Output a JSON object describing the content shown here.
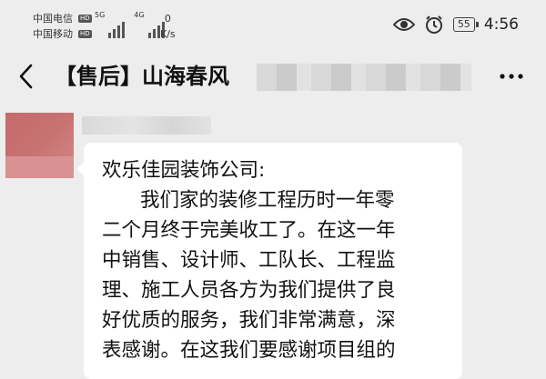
{
  "status_bar": {
    "carrier_1": "中国电信",
    "carrier_2": "中国移动",
    "hd_badge": "HD",
    "signal_1_label": "5G",
    "signal_2_label": "4G",
    "speed_value": "0",
    "speed_unit": "K/s",
    "battery": "55",
    "time": "4:56",
    "icons": [
      "eye-icon",
      "alarm-icon"
    ]
  },
  "header": {
    "title": "【售后】山海春风",
    "back_icon": "chevron-left-icon",
    "more_icon": "more-dots-icon"
  },
  "message": {
    "lines": [
      "欢乐佳园装饰公司:",
      "我们家的装修工程历时一年零",
      "二个月终于完美收工了。在这一年",
      "中销售、设计师、工队长、工程监",
      "理、施工人员各方为我们提供了良",
      "好优质的服务，我们非常满意，深",
      "表感谢。在这我们要感谢项目组的"
    ]
  },
  "colors": {
    "background": "#ededed",
    "bubble": "#ffffff",
    "avatar": "#c87272"
  }
}
